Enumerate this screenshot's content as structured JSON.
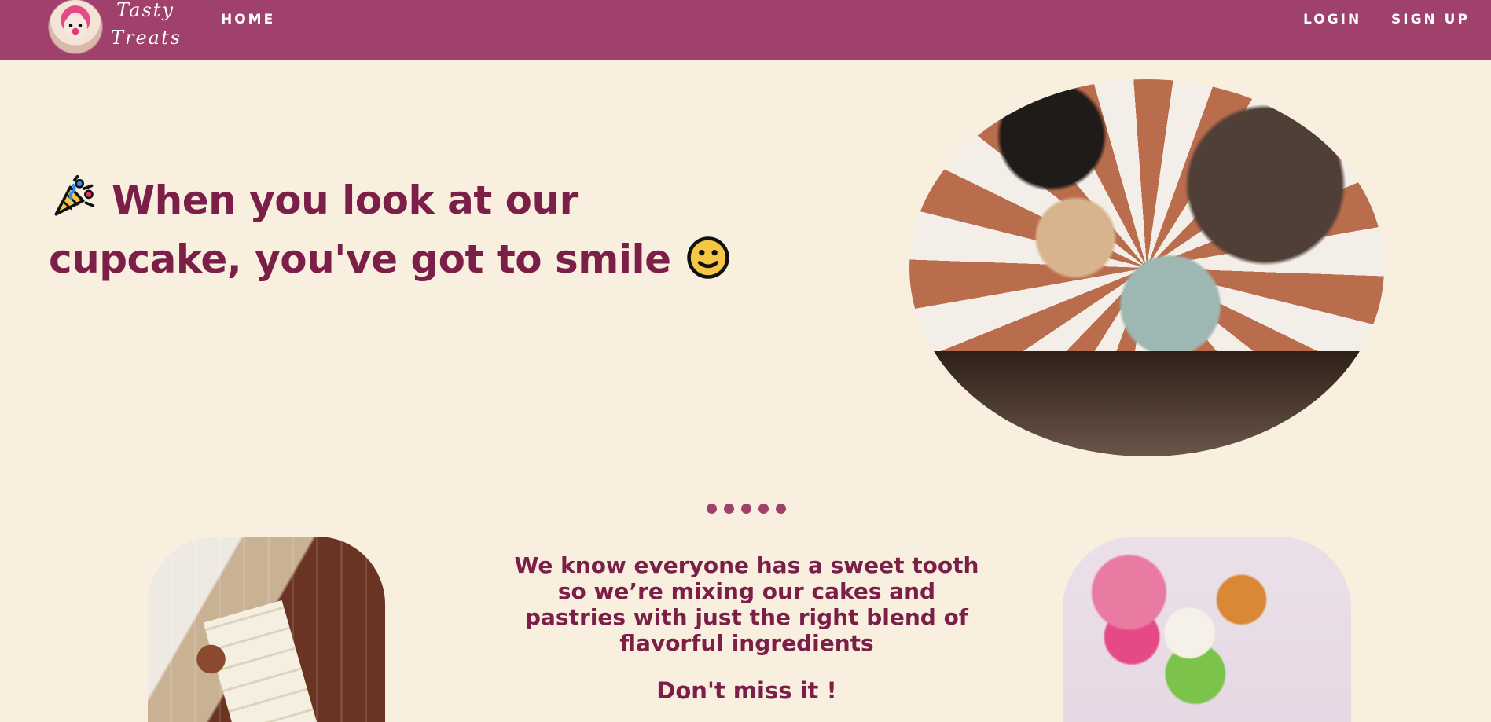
{
  "header": {
    "brand": "Tasty Treats",
    "links": {
      "home": "HOME",
      "login": "LOGIN",
      "signup": "SIGN UP"
    },
    "logo_icon": "cupcake-logo"
  },
  "hero": {
    "title": "When you look at our cupcake, you've got to smile",
    "leading_icon": "party-popper-icon",
    "trailing_icon": "smiling-face-icon",
    "image_name": "cafe-table-photo"
  },
  "carousel": {
    "active_index": 0,
    "count": 5
  },
  "promo": {
    "text": "We know everyone has a sweet tooth so we’re mixing our cakes and pastries with just the right blend of flavorful ingredients",
    "cta": "Don't miss it !",
    "left_image": "chocolate-bar-photo",
    "right_image": "ice-cream-photo"
  },
  "colors": {
    "primary": "#a0406c",
    "background": "#f8efdf",
    "text": "#7c1f48"
  }
}
